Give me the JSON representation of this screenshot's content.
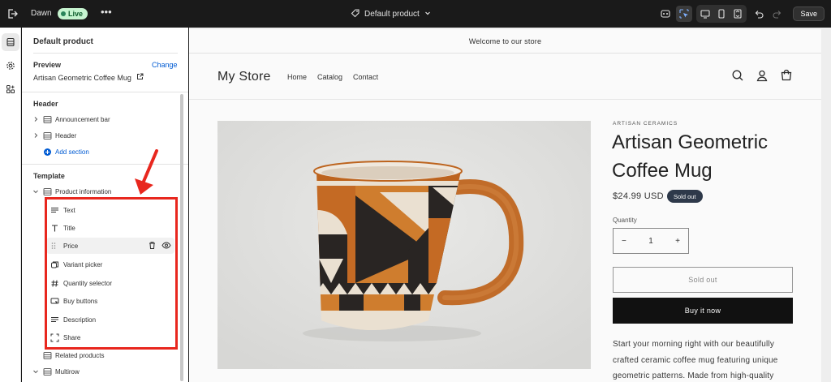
{
  "topbar": {
    "theme_name": "Dawn",
    "live_badge": "Live",
    "more_label": "•••",
    "template_selector": "Default product",
    "save_label": "Save",
    "icons": [
      "exit-icon",
      "ellipsis-icon",
      "tag-icon",
      "chevron-down-icon",
      "inspector-icon",
      "select-icon",
      "desktop-icon",
      "mobile-icon",
      "fullwidth-icon",
      "undo-icon",
      "redo-icon"
    ]
  },
  "rail": {
    "items": [
      {
        "name": "sections",
        "icon": "sections-icon",
        "active": true
      },
      {
        "name": "settings",
        "icon": "gear-icon",
        "active": false
      },
      {
        "name": "apps",
        "icon": "apps-icon",
        "active": false
      }
    ]
  },
  "sidebar": {
    "title": "Default product",
    "preview_label": "Preview",
    "change_label": "Change",
    "preview_value": "Artisan Geometric Coffee Mug",
    "header_group_label": "Header",
    "header_sections": [
      {
        "label": "Announcement bar",
        "icon": "section-icon"
      },
      {
        "label": "Header",
        "icon": "section-icon"
      }
    ],
    "add_section_label": "Add section",
    "template_group_label": "Template",
    "product_section_label": "Product information",
    "blocks": [
      {
        "label": "Text",
        "icon": "text-icon"
      },
      {
        "label": "Title",
        "icon": "title-icon"
      },
      {
        "label": "Price",
        "icon": "none",
        "hovered": true
      },
      {
        "label": "Variant picker",
        "icon": "variant-icon"
      },
      {
        "label": "Quantity selector",
        "icon": "hashtag-icon"
      },
      {
        "label": "Buy buttons",
        "icon": "cursor-button-icon"
      },
      {
        "label": "Description",
        "icon": "text-icon"
      },
      {
        "label": "Share",
        "icon": "share-icon"
      }
    ],
    "related_label": "Related products",
    "multirow_label": "Multirow",
    "highlight_color": "#e8271e"
  },
  "store": {
    "announcement": "Welcome to our store",
    "logo": "My Store",
    "nav": [
      "Home",
      "Catalog",
      "Contact"
    ],
    "header_icons": [
      "search-icon",
      "account-icon",
      "cart-icon"
    ],
    "vendor": "ARTISAN CERAMICS",
    "product_title": "Artisan Geometric Coffee Mug",
    "price": "$24.99 USD",
    "sold_out_badge": "Sold out",
    "quantity_label": "Quantity",
    "quantity_minus": "−",
    "quantity_value": "1",
    "quantity_plus": "+",
    "sold_out_button": "Sold out",
    "buy_now_button": "Buy it now",
    "description": "Start your morning right with our beautifully crafted ceramic coffee mug featuring unique geometric patterns. Made from high-quality"
  },
  "colors": {
    "accent": "#005bd3",
    "live_bg": "#c6f4d0",
    "badge_bg": "#2f3b4c",
    "buy_bg": "#121212"
  }
}
